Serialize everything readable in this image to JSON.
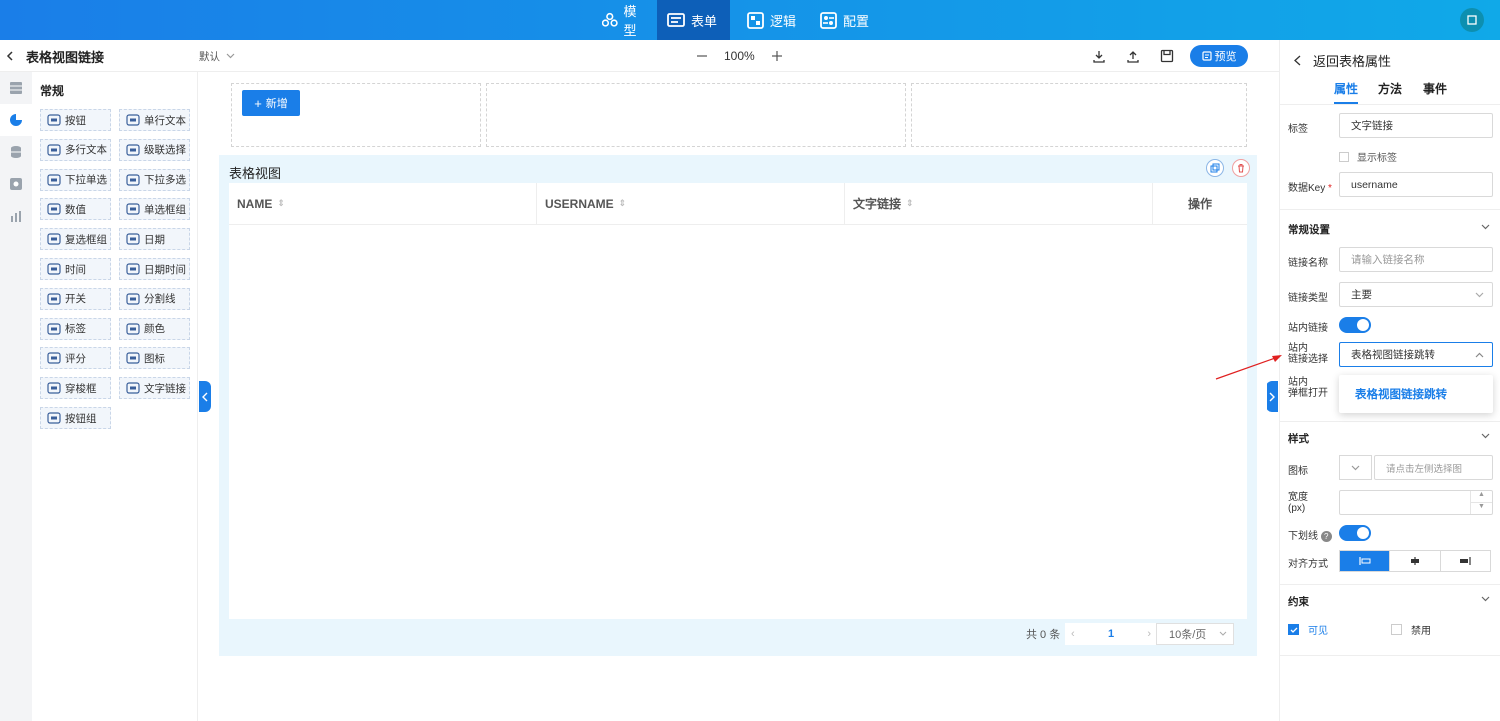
{
  "topnav": {
    "items": [
      {
        "label": "模型",
        "icon": "cluster-icon"
      },
      {
        "label": "表单",
        "icon": "form-icon",
        "active": true
      },
      {
        "label": "逻辑",
        "icon": "logic-icon"
      },
      {
        "label": "配置",
        "icon": "config-icon"
      }
    ]
  },
  "toolbar": {
    "page_title": "表格视图链接",
    "scheme": "默认",
    "zoom": "100%",
    "preview": "预览"
  },
  "palette": {
    "title": "常规",
    "items": [
      "按钮",
      "单行文本",
      "多行文本",
      "级联选择",
      "下拉单选",
      "下拉多选",
      "数值",
      "单选框组",
      "复选框组",
      "日期",
      "时间",
      "日期时间",
      "开关",
      "分割线",
      "标签",
      "颜色",
      "评分",
      "图标",
      "穿梭框",
      "文字链接",
      "按钮组"
    ]
  },
  "canvas": {
    "add_label": "新增",
    "table_title": "表格视图",
    "columns": [
      "NAME",
      "USERNAME",
      "文字链接",
      "操作"
    ],
    "pager": {
      "total": "共 0 条",
      "page": "1",
      "size": "10条/页"
    }
  },
  "props": {
    "back_label": "返回表格属性",
    "tabs": [
      "属性",
      "方法",
      "事件"
    ],
    "label_label": "标签",
    "label_value": "文字链接",
    "show_label": "显示标签",
    "datakey_label": "数据Key",
    "datakey_value": "username",
    "general_section": "常规设置",
    "link_name_label": "链接名称",
    "link_name_placeholder": "请输入链接名称",
    "link_type_label": "链接类型",
    "link_type_value": "主要",
    "internal_link_label": "站内链接",
    "internal_select_label_1": "站内",
    "internal_select_label_2": "链接选择",
    "internal_select_value": "表格视图链接跳转",
    "popup_label_1": "站内",
    "popup_label_2": "弹框打开",
    "dropdown_option": "表格视图链接跳转",
    "style_section": "样式",
    "icon_label": "图标",
    "icon_placeholder": "请点击左侧选择图",
    "width_label_1": "宽度",
    "width_label_2": "(px)",
    "underline_label": "下划线",
    "align_label": "对齐方式",
    "constraint_section": "约束",
    "visible_label": "可见",
    "disabled_label": "禁用"
  },
  "colors": {
    "accent": "#1a7ee8",
    "arrow": "#e02020"
  }
}
